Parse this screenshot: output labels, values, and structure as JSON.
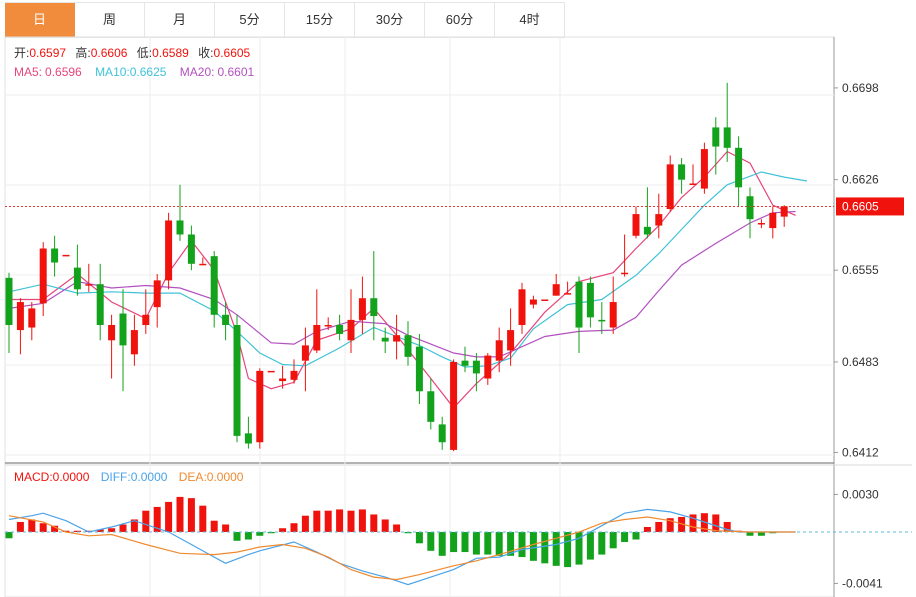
{
  "tabs": [
    "日",
    "周",
    "月",
    "5分",
    "15分",
    "30分",
    "60分",
    "4时"
  ],
  "active_tab": 0,
  "ohlc_info": {
    "open_label": "开:",
    "open": "0.6597",
    "high_label": "高:",
    "high": "0.6606",
    "low_label": "低:",
    "low": "0.6589",
    "close_label": "收:",
    "close": "0.6605"
  },
  "ma_info": {
    "ma5_label": "MA5:",
    "ma5": "0.6596",
    "ma10_label": "MA10:",
    "ma10": "0.6625",
    "ma20_label": "MA20:",
    "ma20": "0.6601"
  },
  "macd_info": {
    "macd_label": "MACD:",
    "macd": "0.0000",
    "diff_label": "DIFF:",
    "diff": "0.0000",
    "dea_label": "DEA:",
    "dea": "0.0000"
  },
  "colors": {
    "up": "#f0120c",
    "down": "#13a21b",
    "ma5": "#e6457a",
    "ma10": "#40c2d6",
    "ma20": "#b350c0",
    "diff": "#4aa3e8",
    "dea": "#f08a30",
    "accent": "#f18c3c"
  },
  "chart_data": [
    {
      "type": "candlestick",
      "title": "",
      "price_axis_ticks": [
        0.6698,
        0.6626,
        0.6555,
        0.6483,
        0.6412
      ],
      "last_price_label": "0.6605",
      "last_price": 0.6605,
      "ylim": [
        0.641,
        0.6705
      ],
      "candles": [
        [
          0.6549,
          0.6512,
          0.6553,
          0.649
        ],
        [
          0.6508,
          0.653,
          0.6533,
          0.6489
        ],
        [
          0.651,
          0.6525,
          0.653,
          0.65
        ],
        [
          0.6529,
          0.6572,
          0.6577,
          0.6519
        ],
        [
          0.6572,
          0.6561,
          0.6582,
          0.655
        ],
        [
          0.6567,
          0.6567,
          0.6567,
          0.6567
        ],
        [
          0.6557,
          0.654,
          0.6575,
          0.6535
        ],
        [
          0.6544,
          0.6544,
          0.656,
          0.6538
        ],
        [
          0.6544,
          0.6512,
          0.656,
          0.65
        ],
        [
          0.65,
          0.6512,
          0.652,
          0.647
        ],
        [
          0.6521,
          0.6496,
          0.654,
          0.646
        ],
        [
          0.6489,
          0.6508,
          0.652,
          0.648
        ],
        [
          0.6512,
          0.652,
          0.654,
          0.6505
        ],
        [
          0.6526,
          0.6547,
          0.6552,
          0.651
        ],
        [
          0.6547,
          0.6594,
          0.66,
          0.654
        ],
        [
          0.6594,
          0.6583,
          0.6622,
          0.6578
        ],
        [
          0.6583,
          0.656,
          0.659,
          0.6555
        ],
        [
          0.656,
          0.656,
          0.6565,
          0.656
        ],
        [
          0.6566,
          0.652,
          0.657,
          0.651
        ],
        [
          0.652,
          0.6512,
          0.653,
          0.65
        ],
        [
          0.6512,
          0.6425,
          0.652,
          0.642
        ],
        [
          0.6427,
          0.6419,
          0.644,
          0.6415
        ],
        [
          0.642,
          0.6476,
          0.6478,
          0.6415
        ],
        [
          0.6476,
          0.6476,
          0.6476,
          0.6476
        ],
        [
          0.6468,
          0.647,
          0.648,
          0.6462
        ],
        [
          0.6469,
          0.6476,
          0.6485,
          0.6466
        ],
        [
          0.6484,
          0.6496,
          0.651,
          0.646
        ],
        [
          0.6492,
          0.6512,
          0.654,
          0.649
        ],
        [
          0.6512,
          0.6512,
          0.6518,
          0.6508
        ],
        [
          0.6512,
          0.6505,
          0.652,
          0.65
        ],
        [
          0.65,
          0.6516,
          0.654,
          0.649
        ],
        [
          0.6516,
          0.6533,
          0.655,
          0.6505
        ],
        [
          0.6533,
          0.6519,
          0.657,
          0.65
        ],
        [
          0.6502,
          0.6499,
          0.651,
          0.649
        ],
        [
          0.6499,
          0.6504,
          0.652,
          0.6485
        ],
        [
          0.6504,
          0.6487,
          0.6515,
          0.648
        ],
        [
          0.6495,
          0.646,
          0.6505,
          0.645
        ],
        [
          0.646,
          0.6436,
          0.647,
          0.643
        ],
        [
          0.6434,
          0.642,
          0.644,
          0.6414
        ],
        [
          0.6414,
          0.6483,
          0.6485,
          0.6413
        ],
        [
          0.6484,
          0.648,
          0.6495,
          0.6475
        ],
        [
          0.6484,
          0.6474,
          0.649,
          0.646
        ],
        [
          0.647,
          0.6488,
          0.649,
          0.6465
        ],
        [
          0.6484,
          0.65,
          0.651,
          0.6475
        ],
        [
          0.6492,
          0.6508,
          0.6525,
          0.648
        ],
        [
          0.6512,
          0.654,
          0.6545,
          0.6505
        ],
        [
          0.6528,
          0.6532,
          0.6535,
          0.6525
        ],
        [
          0.6532,
          0.6532,
          0.6532,
          0.6532
        ],
        [
          0.6535,
          0.6544,
          0.6552,
          0.6535
        ],
        [
          0.6537,
          0.6537,
          0.6546,
          0.6537
        ],
        [
          0.6546,
          0.651,
          0.655,
          0.649
        ],
        [
          0.6545,
          0.6518,
          0.655,
          0.651
        ],
        [
          0.6516,
          0.6515,
          0.653,
          0.6505
        ],
        [
          0.651,
          0.653,
          0.655,
          0.6505
        ],
        [
          0.6553,
          0.6553,
          0.6583,
          0.655
        ],
        [
          0.6582,
          0.6599,
          0.6605,
          0.658
        ],
        [
          0.6589,
          0.6583,
          0.662,
          0.658
        ],
        [
          0.659,
          0.6599,
          0.6615,
          0.658
        ],
        [
          0.6603,
          0.6638,
          0.6645,
          0.6601
        ],
        [
          0.6638,
          0.6626,
          0.6643,
          0.6615
        ],
        [
          0.6623,
          0.6623,
          0.6638,
          0.6623
        ],
        [
          0.6619,
          0.665,
          0.6655,
          0.6615
        ],
        [
          0.6667,
          0.6652,
          0.6675,
          0.663
        ],
        [
          0.6667,
          0.6651,
          0.6702,
          0.664
        ],
        [
          0.6651,
          0.662,
          0.666,
          0.6605
        ],
        [
          0.6613,
          0.6595,
          0.662,
          0.658
        ],
        [
          0.6592,
          0.6592,
          0.6595,
          0.6588
        ],
        [
          0.6588,
          0.66,
          0.6605,
          0.658
        ],
        [
          0.6597,
          0.6605,
          0.6606,
          0.6589
        ]
      ],
      "ma5": [
        [
          0,
          0.6532
        ],
        [
          3,
          0.6532
        ],
        [
          6,
          0.6552
        ],
        [
          9,
          0.653
        ],
        [
          12,
          0.6517
        ],
        [
          14,
          0.6553
        ],
        [
          16,
          0.6578
        ],
        [
          18,
          0.6555
        ],
        [
          20,
          0.6505
        ],
        [
          21,
          0.647
        ],
        [
          23,
          0.6462
        ],
        [
          25,
          0.6467
        ],
        [
          27,
          0.65
        ],
        [
          30,
          0.6509
        ],
        [
          32,
          0.6525
        ],
        [
          34,
          0.6504
        ],
        [
          37,
          0.647
        ],
        [
          39,
          0.6447
        ],
        [
          41,
          0.6466
        ],
        [
          44,
          0.649
        ],
        [
          47,
          0.6522
        ],
        [
          50,
          0.6546
        ],
        [
          53,
          0.6553
        ],
        [
          55,
          0.6572
        ],
        [
          57,
          0.659
        ],
        [
          59,
          0.6612
        ],
        [
          61,
          0.6628
        ],
        [
          63,
          0.6648
        ],
        [
          65,
          0.6639
        ],
        [
          67,
          0.6606
        ],
        [
          69,
          0.6598
        ]
      ],
      "ma10": [
        [
          0,
          0.6538
        ],
        [
          3,
          0.6544
        ],
        [
          6,
          0.6537
        ],
        [
          9,
          0.6538
        ],
        [
          12,
          0.6537
        ],
        [
          15,
          0.6537
        ],
        [
          18,
          0.6523
        ],
        [
          20,
          0.6507
        ],
        [
          22,
          0.649
        ],
        [
          24,
          0.6481
        ],
        [
          26,
          0.648
        ],
        [
          29,
          0.6494
        ],
        [
          32,
          0.651
        ],
        [
          34,
          0.6503
        ],
        [
          36,
          0.6496
        ],
        [
          38,
          0.6487
        ],
        [
          40,
          0.6479
        ],
        [
          42,
          0.648
        ],
        [
          44,
          0.6486
        ],
        [
          46,
          0.6509
        ],
        [
          49,
          0.6528
        ],
        [
          52,
          0.6532
        ],
        [
          55,
          0.6551
        ],
        [
          57,
          0.6568
        ],
        [
          59,
          0.6587
        ],
        [
          61,
          0.6606
        ],
        [
          63,
          0.6622
        ],
        [
          66,
          0.6632
        ],
        [
          68,
          0.6628
        ],
        [
          70,
          0.6625
        ]
      ],
      "ma20": [
        [
          0,
          0.6525
        ],
        [
          3,
          0.6529
        ],
        [
          6,
          0.6546
        ],
        [
          9,
          0.6541
        ],
        [
          12,
          0.6543
        ],
        [
          15,
          0.6541
        ],
        [
          18,
          0.6532
        ],
        [
          20,
          0.652
        ],
        [
          23,
          0.6498
        ],
        [
          25,
          0.6497
        ],
        [
          27,
          0.6507
        ],
        [
          30,
          0.6515
        ],
        [
          33,
          0.6513
        ],
        [
          35,
          0.6504
        ],
        [
          37,
          0.6497
        ],
        [
          39,
          0.649
        ],
        [
          41,
          0.6487
        ],
        [
          43,
          0.6487
        ],
        [
          45,
          0.6495
        ],
        [
          47,
          0.6503
        ],
        [
          50,
          0.6507
        ],
        [
          53,
          0.6508
        ],
        [
          55,
          0.6518
        ],
        [
          57,
          0.6539
        ],
        [
          59,
          0.6559
        ],
        [
          62,
          0.6576
        ],
        [
          65,
          0.6592
        ],
        [
          67,
          0.66
        ],
        [
          69,
          0.6601
        ]
      ]
    },
    {
      "type": "macd",
      "axis_ticks": [
        0.003,
        -0.0041
      ],
      "ylim": [
        -0.0049,
        0.0035
      ],
      "histogram": [
        -0.0005,
        0.0008,
        0.001,
        0.0007,
        0.0005,
        0.0001,
        0.0001,
        0.0001,
        0.0002,
        0.0003,
        0.0006,
        0.001,
        0.0017,
        0.002,
        0.0024,
        0.0028,
        0.0027,
        0.0021,
        0.0009,
        0.0006,
        -0.0007,
        -0.0006,
        -0.0003,
        -0.0001,
        0.0003,
        0.0007,
        0.0013,
        0.0017,
        0.0017,
        0.0018,
        0.0017,
        0.0018,
        0.0014,
        0.001,
        0.0006,
        -0.0001,
        -0.0009,
        -0.0015,
        -0.0019,
        -0.0016,
        -0.0016,
        -0.0018,
        -0.0018,
        -0.0019,
        -0.0019,
        -0.002,
        -0.0023,
        -0.0025,
        -0.0027,
        -0.0028,
        -0.0026,
        -0.0022,
        -0.0018,
        -0.0013,
        -0.0008,
        -0.0006,
        0.0004,
        0.0008,
        0.0011,
        0.0012,
        0.0014,
        0.0015,
        0.0014,
        0.0008,
        0.0001,
        -0.0003,
        -0.0003,
        -0.0001,
        0.0,
        0.0
      ],
      "diff": [
        [
          0,
          0.001
        ],
        [
          2,
          0.0013
        ],
        [
          3,
          0.0015
        ],
        [
          5,
          0.0009
        ],
        [
          7,
          0.0
        ],
        [
          9,
          0.0004
        ],
        [
          11,
          0.0009
        ],
        [
          14,
          0.0
        ],
        [
          16,
          -0.001
        ],
        [
          18,
          -0.002
        ],
        [
          19,
          -0.0025
        ],
        [
          21,
          -0.0018
        ],
        [
          22,
          -0.0015
        ],
        [
          25,
          -0.0008
        ],
        [
          27,
          -0.0016
        ],
        [
          29,
          -0.0025
        ],
        [
          31,
          -0.0031
        ],
        [
          33,
          -0.0036
        ],
        [
          35,
          -0.0042
        ],
        [
          37,
          -0.0036
        ],
        [
          39,
          -0.003
        ],
        [
          41,
          -0.0021
        ],
        [
          43,
          -0.002
        ],
        [
          45,
          -0.0014
        ],
        [
          48,
          -0.001
        ],
        [
          50,
          -0.0005
        ],
        [
          52,
          0.0005
        ],
        [
          54,
          0.0015
        ],
        [
          56,
          0.0018
        ],
        [
          58,
          0.0016
        ],
        [
          60,
          0.0011
        ],
        [
          61,
          0.0008
        ],
        [
          63,
          0.0002
        ],
        [
          64,
          0.0
        ],
        [
          66,
          0.0
        ],
        [
          69,
          0.0
        ]
      ],
      "dea": [
        [
          0,
          0.0013
        ],
        [
          3,
          0.0008
        ],
        [
          5,
          0.0
        ],
        [
          7,
          -0.0003
        ],
        [
          9,
          -0.0002
        ],
        [
          12,
          -0.001
        ],
        [
          15,
          -0.0017
        ],
        [
          18,
          -0.0018
        ],
        [
          20,
          -0.0016
        ],
        [
          22,
          -0.0012
        ],
        [
          24,
          -0.001
        ],
        [
          26,
          -0.0013
        ],
        [
          28,
          -0.002
        ],
        [
          30,
          -0.003
        ],
        [
          32,
          -0.0036
        ],
        [
          34,
          -0.0038
        ],
        [
          36,
          -0.0034
        ],
        [
          39,
          -0.0027
        ],
        [
          41,
          -0.0023
        ],
        [
          43,
          -0.0018
        ],
        [
          46,
          -0.001
        ],
        [
          48,
          -0.0005
        ],
        [
          50,
          0.0
        ],
        [
          52,
          0.0007
        ],
        [
          54,
          0.001
        ],
        [
          56,
          0.0012
        ],
        [
          58,
          0.0009
        ],
        [
          60,
          0.0004
        ],
        [
          62,
          0.0001
        ],
        [
          65,
          0.0
        ],
        [
          69,
          0.0
        ]
      ]
    }
  ]
}
